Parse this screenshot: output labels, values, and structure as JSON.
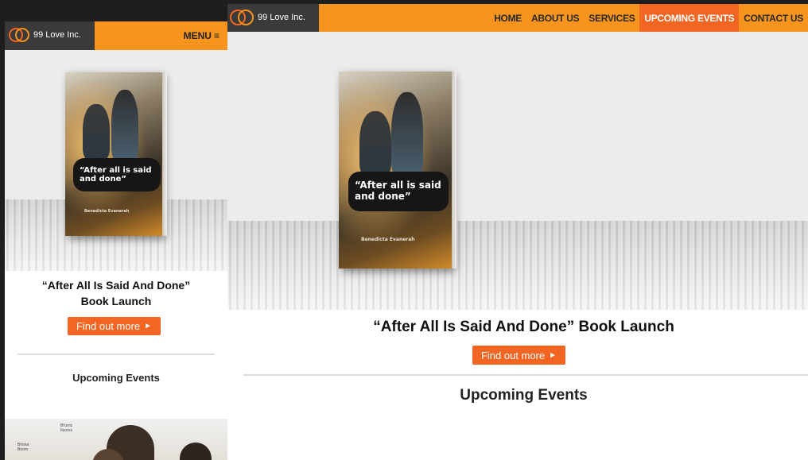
{
  "brand": {
    "name": "99 Love Inc.",
    "accent": "#f7941d",
    "cta_color": "#f26522",
    "logo_bg": "#3a3a3a"
  },
  "mobile": {
    "menu_label": "MENU",
    "menu_icon": "hamburger-icon",
    "event_title_line1": "“After All Is Said And Done”",
    "event_title_line2": "Book Launch",
    "cta_label": "Find out more",
    "section_heading": "Upcoming Events"
  },
  "desktop": {
    "nav": [
      {
        "label": "HOME",
        "active": false
      },
      {
        "label": "ABOUT US",
        "active": false
      },
      {
        "label": "SERVICES",
        "active": false
      },
      {
        "label": "UPCOMING EVENTS",
        "active": true
      },
      {
        "label": "CONTACT US",
        "active": false
      }
    ],
    "event_title": "“After All Is Said And Done”  Book Launch",
    "cta_label": "Find out more",
    "section_heading": "Upcoming Events"
  },
  "book": {
    "title_line1": "“After all is said",
    "title_line2": "and done”",
    "author": "Benedicta Evanerah"
  },
  "thumb_text": {
    "line1": "Bl'urriz",
    "line2": "Itsores",
    "line3": "Brisna",
    "line4": "Boom"
  }
}
